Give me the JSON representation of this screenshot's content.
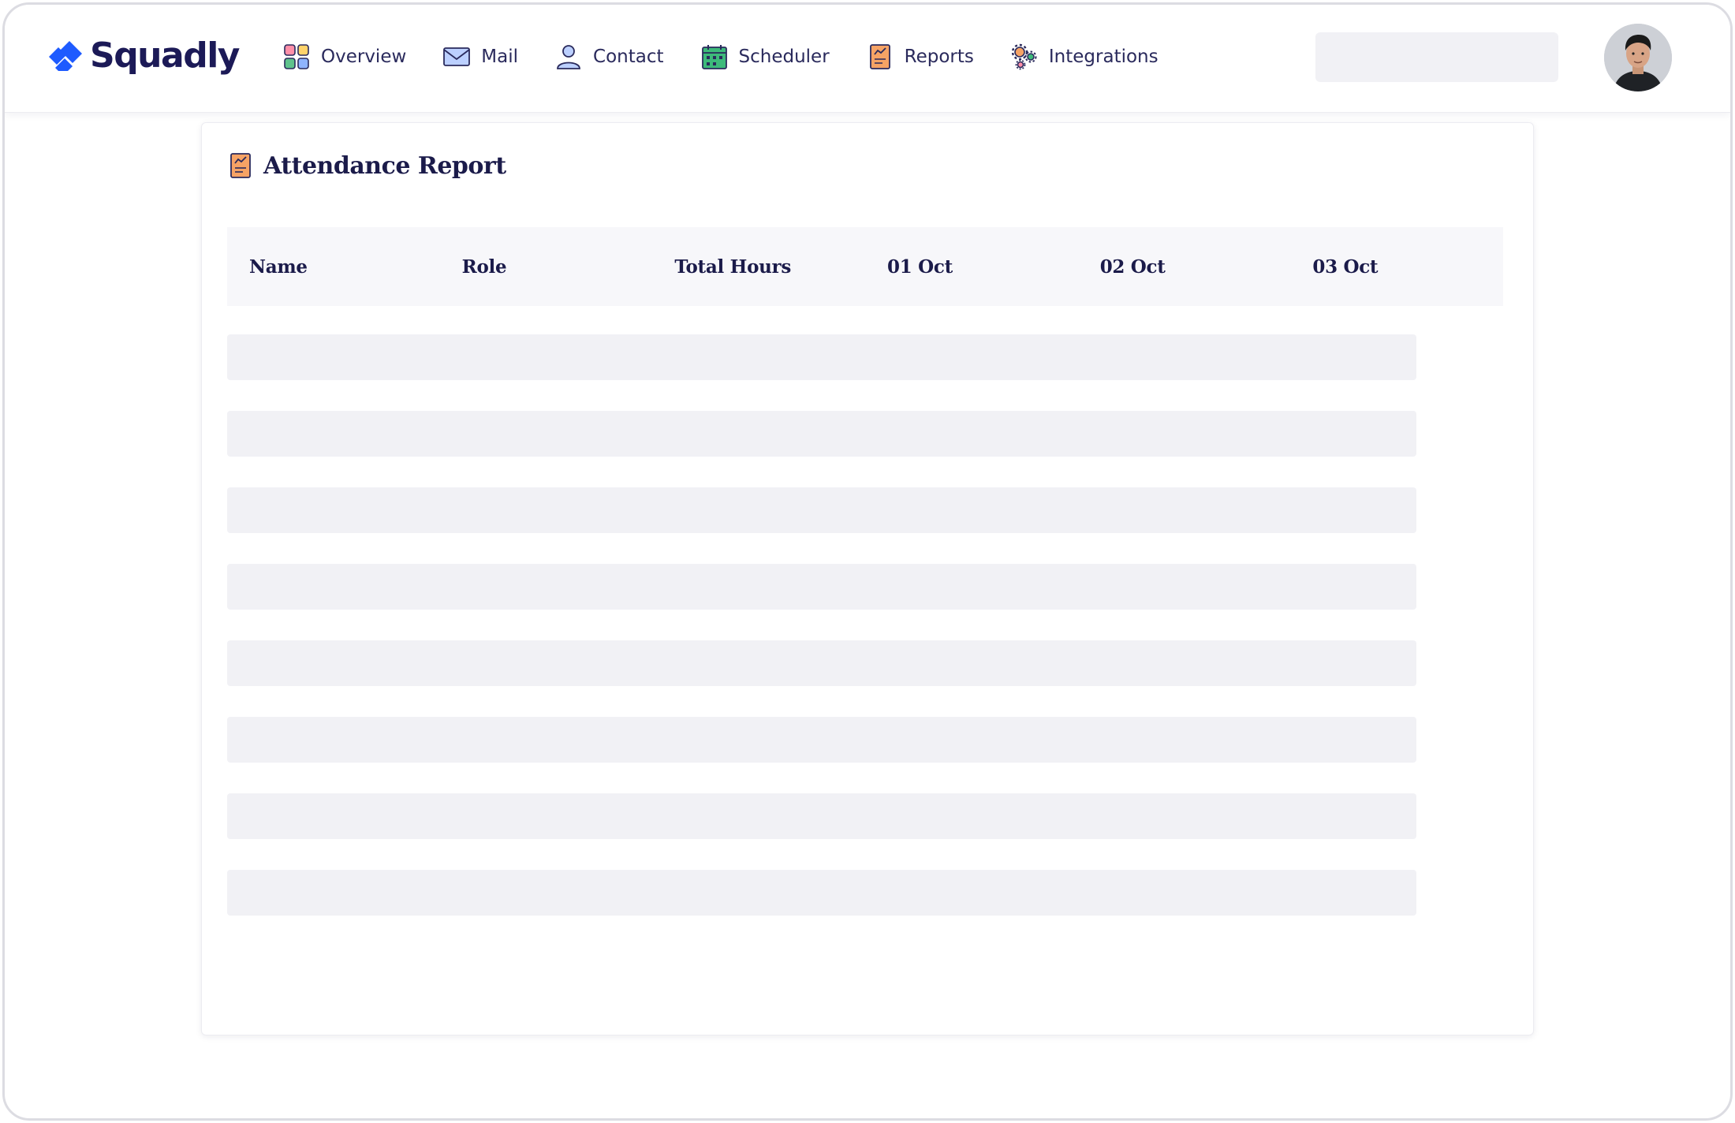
{
  "app": {
    "brand": "Squadly",
    "accent": "#1e5bff",
    "brand_text_color": "#1c1a57"
  },
  "nav": {
    "items": [
      {
        "label": "Overview",
        "icon": "grid-icon"
      },
      {
        "label": "Mail",
        "icon": "mail-icon"
      },
      {
        "label": "Contact",
        "icon": "user-icon"
      },
      {
        "label": "Scheduler",
        "icon": "calendar-icon"
      },
      {
        "label": "Reports",
        "icon": "report-icon"
      },
      {
        "label": "Integrations",
        "icon": "gears-icon"
      }
    ]
  },
  "header": {
    "search_value": "",
    "avatar_icon": "avatar"
  },
  "report": {
    "title": "Attendance Report",
    "icon": "report-icon",
    "columns": [
      "Name",
      "Role",
      "Total Hours",
      "01 Oct",
      "02 Oct",
      "03 Oct"
    ],
    "rows_loading": 8
  }
}
